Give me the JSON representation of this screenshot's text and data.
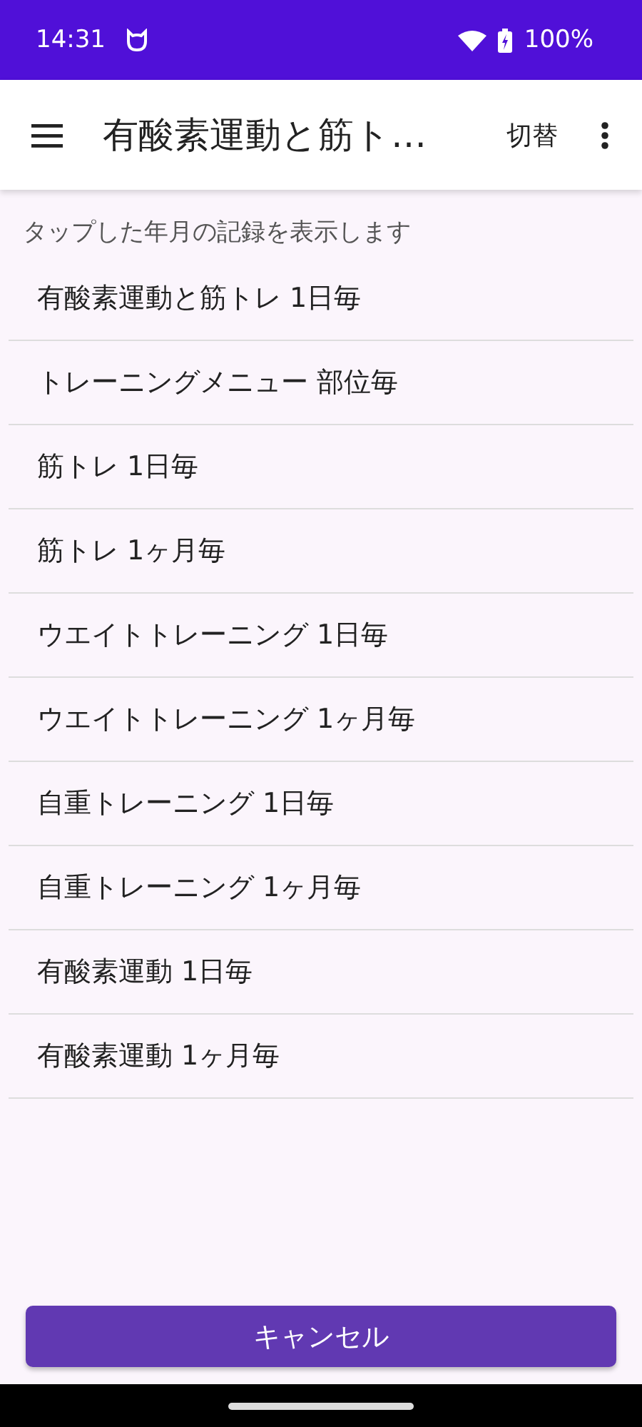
{
  "status_bar": {
    "time": "14:31",
    "battery": "100%"
  },
  "app_bar": {
    "title": "有酸素運動と筋ト…",
    "action": "切替"
  },
  "hint": "タップした年月の記録を表示します",
  "items": [
    {
      "label": "有酸素運動と筋トレ 1日毎"
    },
    {
      "label": "トレーニングメニュー 部位毎"
    },
    {
      "label": "筋トレ 1日毎"
    },
    {
      "label": "筋トレ 1ヶ月毎"
    },
    {
      "label": "ウエイトトレーニング 1日毎"
    },
    {
      "label": "ウエイトトレーニング 1ヶ月毎"
    },
    {
      "label": "自重トレーニング 1日毎"
    },
    {
      "label": "自重トレーニング 1ヶ月毎"
    },
    {
      "label": "有酸素運動 1日毎"
    },
    {
      "label": "有酸素運動 1ヶ月毎"
    }
  ],
  "cancel_button": "キャンセル"
}
